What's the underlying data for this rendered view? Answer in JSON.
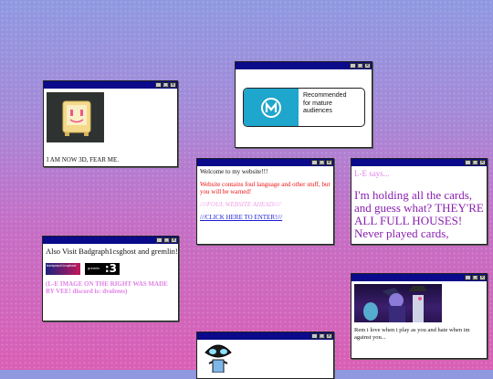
{
  "window_controls": {
    "minimize": "_",
    "maximize": "□",
    "close": "×"
  },
  "w1": {
    "caption": "I AM NOW 3D, FEAR ME."
  },
  "w2": {
    "rating_lines": [
      "Recommended",
      "for mature",
      "audiences"
    ]
  },
  "w3": {
    "welcome": "Welcome to my website!!!",
    "warning": "Website contains foul language and other stuff, but you will be warned!",
    "warning_ahead": "////FOUL WEBSITE AHEAD////",
    "enter_link": "///CLICK HERE TO ENTER!///"
  },
  "w4": {
    "heading": "L-E says...",
    "body": "I'm holding all the cards, and guess what? THEY'RE ALL FULL HOUSES! Never played cards,"
  },
  "w5": {
    "visit": "Also Visit Badgraph1csghost and gremlin!",
    "badge1": "badgraph1csghost",
    "badge2": "gremlin",
    "credit": "(L-E IMAGE ON THE RIGHT WAS MADE BY VEE! discord is: dvolrees)"
  },
  "w6": {
    "caption": "Rem i love when i play as you and hate when im against you..."
  },
  "colors": {
    "titlebar": "#0a0a8a",
    "warning_red": "#ee1111",
    "pink": "#e080e8",
    "link_blue": "#1a1ad8",
    "le_purple": "#8a1fb0"
  }
}
